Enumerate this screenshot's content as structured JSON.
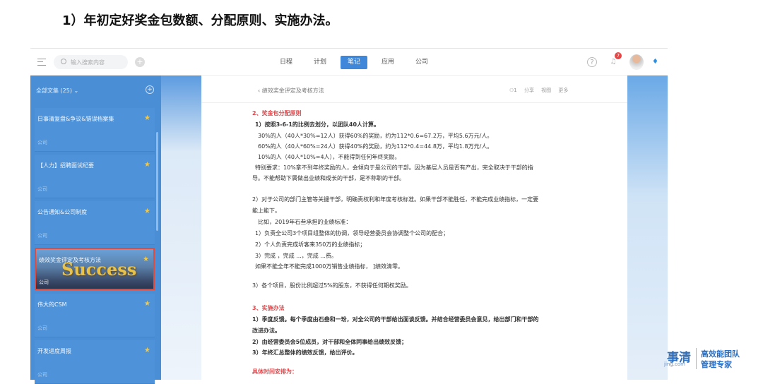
{
  "heading": "1）年初定好奖金包数额、分配原则、实施办法。",
  "topbar": {
    "search_placeholder": "输入搜索内容",
    "add": "+",
    "nav": [
      "日程",
      "计划",
      "笔记",
      "应用",
      "公司"
    ],
    "active_nav": "笔记",
    "help": "?",
    "bell": "♫",
    "badge": "7",
    "vip": "♦"
  },
  "sidebar": {
    "header": "全部文集 (25) ⌄",
    "add": "+",
    "items": [
      {
        "title": "日事清复盘&争议&错误档案集",
        "sub": "公司",
        "star": "★"
      },
      {
        "title": "【人力】招聘面试纪要",
        "sub": "公司",
        "star": "★"
      },
      {
        "title": "公告通知&公司制度",
        "sub": "公司",
        "star": "★"
      },
      {
        "title": "绩效奖金评定及考核方法",
        "sub": "公司",
        "star": "★",
        "cover": "Success"
      },
      {
        "title": "伟大的CSM",
        "sub": "公司",
        "star": "★"
      },
      {
        "title": "开发进度周报",
        "sub": "公司",
        "star": "★"
      }
    ]
  },
  "document": {
    "back": "‹  绩效奖金评定及考核方法",
    "tools": "⚇1 分享 视图 更多",
    "lines": [
      "2、奖金包分配原则",
      "1）按照3-6-1的比例去划分，以团队40人计算。",
      "30%的人（40人*30%=12人）获得60%的奖励，约为112*0.6=67.2万，平均5.6万元/人。",
      "60%的人（40人*60%=24人）获得40%的奖励，约为112*0.4=44.8万，平均1.8万元/人。",
      "10%的人（40人*10%=4人），不能得到任何年终奖励。",
      "特别要求：10%拿不到年终奖励的人，会倾向于是公司的干部。因为基层人员是否有产出，完全取决于干部的指",
      "导。不能帮助下属做出业绩和成长的干部，是不称职的干部。",
      "2）对于公司的部门主管等关键干部，明确责权利和年度考核标准。如果干部不能胜任，不能完成业绩指标，一定要",
      "能上能下。",
      "比如，2019年石叁承担的业绩标准：",
      "1）负责全公司3个项目组整体的协调，领导经营委员会协调整个公司的配合；",
      "2）个人负责完成圻客来350万的业绩指标；",
      "3）完成                              ，完成                              ...，完成                                   ...费。",
      "如果不能全年不能完成1000万销售业绩指标，          ]绩效清零。",
      "3）各个项目，股份比例超过5%的股东，不获得任何期权奖励。",
      "3、实施办法",
      "1）季度反馈。每个季度由石叁和一玢，对全公司的干部给出面谈反馈。并结合经营委员会意见，给出部门和干部的",
      "改进办法。",
      "2）由经营委员会5位成员，对干部和全体同事给出绩效反馈；",
      "3）年终汇总整体的绩效反馈，给出评价。",
      "具体时间安排为："
    ]
  },
  "logo": {
    "brand": "事清",
    "domain": "jing.com",
    "slogan1": "高效能团队",
    "slogan2": "管理专家"
  },
  "colors": {
    "accent": "#3f87d8",
    "sidebar": "#4a8fd6",
    "heading_red": "#e0464a",
    "star": "#f5c842",
    "selection": "#e24b3b"
  }
}
